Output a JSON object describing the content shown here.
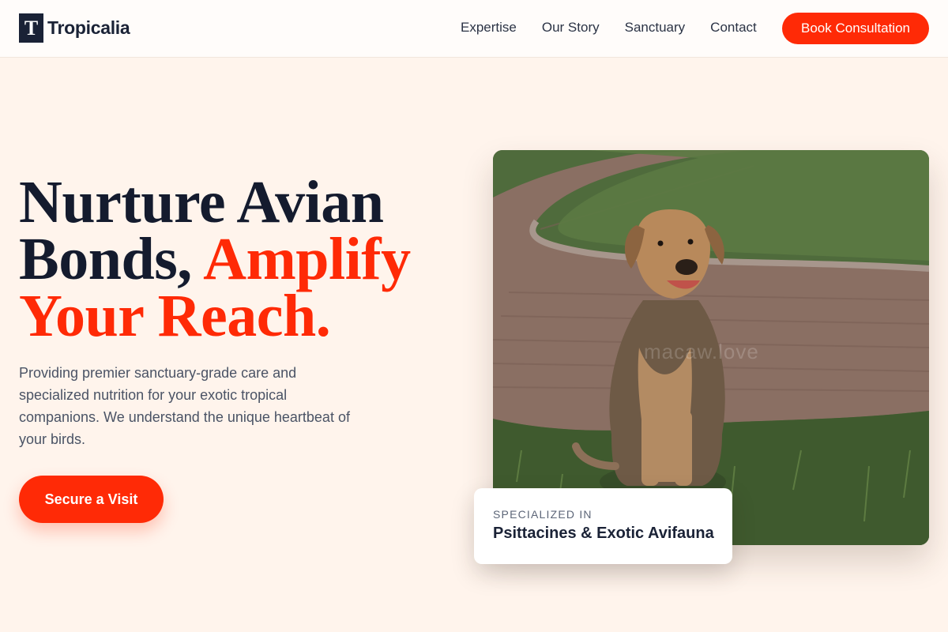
{
  "header": {
    "logo_mark": "T",
    "logo_text": "Tropicalia",
    "nav": [
      "Expertise",
      "Our Story",
      "Sanctuary",
      "Contact"
    ],
    "cta_label": "Book Consultation"
  },
  "hero": {
    "headline_line1": "Nurture Avian",
    "headline_line2_plain": "Bonds, ",
    "headline_line2_accent": "Amplify",
    "headline_line3_accent": "Your Reach.",
    "subtext": "Providing premier sanctuary-grade care and specialized nutrition for your exotic tropical companions. We understand the unique heartbeat of your birds.",
    "cta_label": "Secure a Visit"
  },
  "image_card": {
    "watermark": "macaw.love",
    "badge_label": "SPECIALIZED IN",
    "badge_value": "Psittacines & Exotic Avifauna"
  },
  "colors": {
    "accent": "#ff2a06",
    "navy": "#141b2e",
    "page_bg": "#fff4ec"
  }
}
